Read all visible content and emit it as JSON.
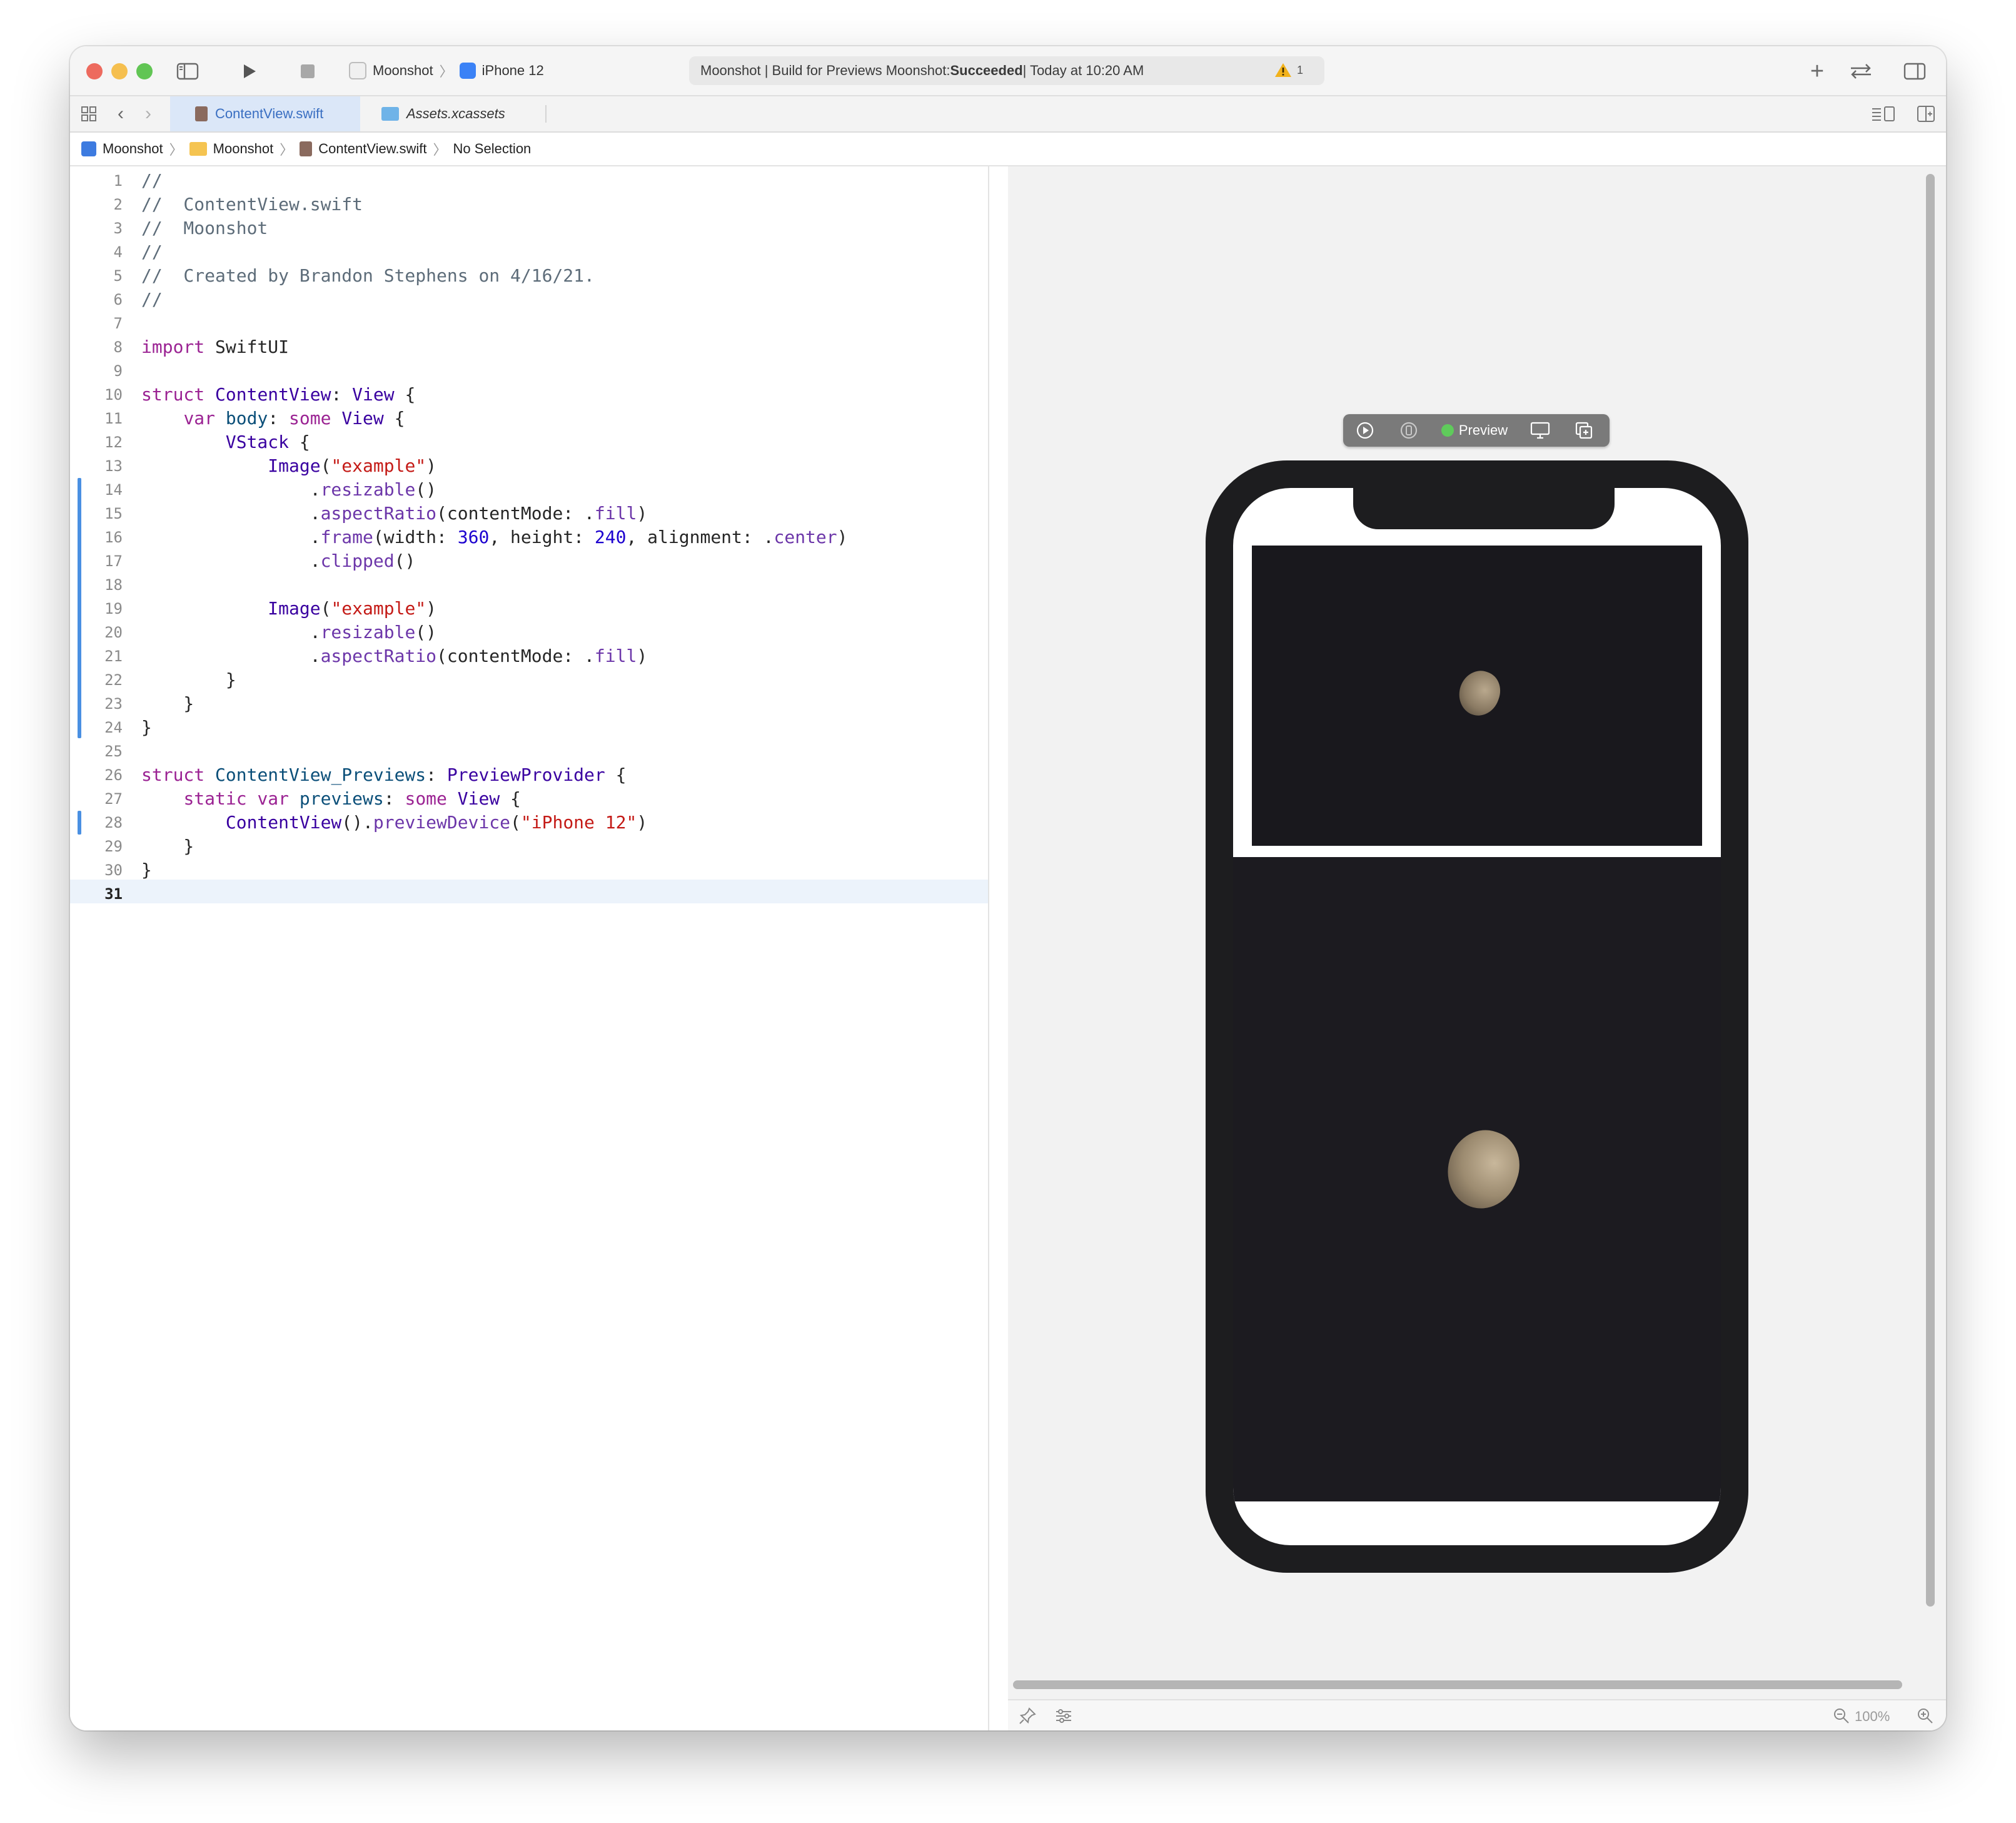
{
  "toolbar": {
    "scheme_project": "Moonshot",
    "scheme_device": "iPhone 12",
    "status_prefix": "Moonshot | Build for Previews Moonshot: ",
    "status_result": "Succeeded",
    "status_time": " | Today at 10:20 AM",
    "warning_count": "1"
  },
  "tabs": [
    {
      "label": "ContentView.swift",
      "active": true
    },
    {
      "label": "Assets.xcassets",
      "active": false
    }
  ],
  "breadcrumb": {
    "project": "Moonshot",
    "group": "Moonshot",
    "file": "ContentView.swift",
    "selection": "No Selection"
  },
  "code_lines": [
    "//",
    "//  ContentView.swift",
    "//  Moonshot",
    "//",
    "//  Created by Brandon Stephens on 4/16/21.",
    "//",
    "",
    "import SwiftUI",
    "",
    "struct ContentView: View {",
    "    var body: some View {",
    "        VStack {",
    "            Image(\"example\")",
    "                .resizable()",
    "                .aspectRatio(contentMode: .fill)",
    "                .frame(width: 360, height: 240, alignment: .center)",
    "                .clipped()",
    "",
    "            Image(\"example\")",
    "                .resizable()",
    "                .aspectRatio(contentMode: .fill)",
    "        }",
    "    }",
    "}",
    "",
    "struct ContentView_Previews: PreviewProvider {",
    "    static var previews: some View {",
    "        ContentView().previewDevice(\"iPhone 12\")",
    "    }",
    "}",
    ""
  ],
  "current_line": 31,
  "preview": {
    "label": "Preview",
    "status_color": "#5fcb5b"
  },
  "canvas": {
    "zoom": "100%"
  },
  "colors": {
    "accent": "#4a90e2",
    "keyword": "#9b2393",
    "string": "#c41a16",
    "number": "#1c00cf",
    "comment": "#5d6c79"
  }
}
